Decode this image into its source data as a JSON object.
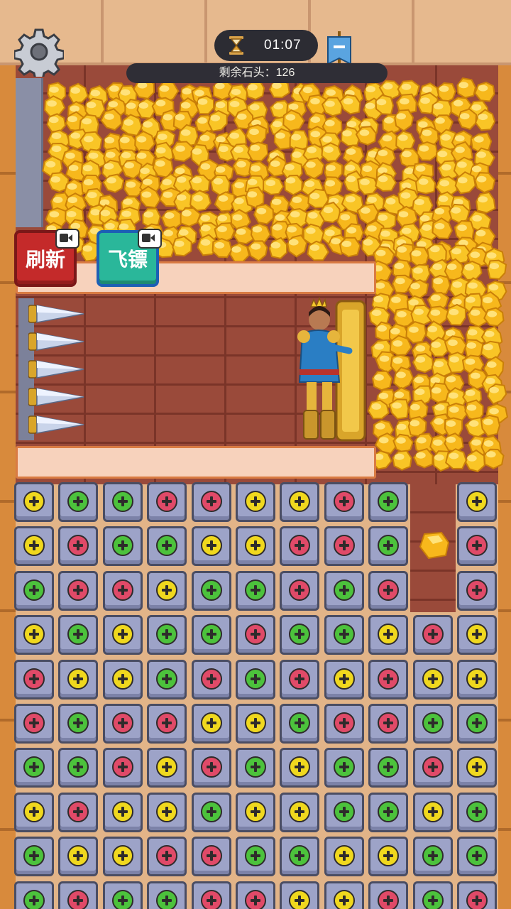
{
  "hud": {
    "timer": "01:07",
    "stones_text": "剩余石头：126"
  },
  "buttons": {
    "refresh_label": "刷新",
    "dart_label": "飞镖"
  },
  "icons": {
    "settings": "gear-icon",
    "timer": "hourglass-icon",
    "flag": "banner-flag-icon",
    "video": "video-ad-icon"
  },
  "colors": {
    "screw_yellow": "#f0d81e",
    "screw_green": "#4cc23c",
    "screw_red": "#e04a68",
    "gold": "#f7b81c",
    "tile": "#9da3c8"
  },
  "board": {
    "rows": [
      [
        "Y",
        "G",
        "G",
        "R",
        "R",
        "Y",
        "Y",
        "R",
        "G",
        "",
        "Y"
      ],
      [
        "Y",
        "R",
        "G",
        "G",
        "Y",
        "Y",
        "R",
        "R",
        "G",
        "",
        "R"
      ],
      [
        "G",
        "R",
        "R",
        "Y",
        "G",
        "G",
        "R",
        "G",
        "R",
        "",
        "R"
      ],
      [
        "Y",
        "G",
        "Y",
        "G",
        "G",
        "R",
        "G",
        "G",
        "Y",
        "R",
        "Y"
      ],
      [
        "R",
        "Y",
        "Y",
        "G",
        "R",
        "G",
        "R",
        "Y",
        "R",
        "Y",
        "Y"
      ],
      [
        "R",
        "G",
        "R",
        "R",
        "Y",
        "Y",
        "G",
        "R",
        "R",
        "G",
        "G"
      ],
      [
        "G",
        "G",
        "R",
        "Y",
        "R",
        "G",
        "Y",
        "G",
        "G",
        "R",
        "Y"
      ],
      [
        "Y",
        "R",
        "Y",
        "Y",
        "G",
        "Y",
        "Y",
        "G",
        "G",
        "Y",
        "G"
      ],
      [
        "G",
        "Y",
        "Y",
        "R",
        "R",
        "G",
        "G",
        "Y",
        "Y",
        "G",
        "G"
      ],
      [
        "G",
        "R",
        "G",
        "G",
        "R",
        "R",
        "Y",
        "Y",
        "R",
        "G",
        "R"
      ]
    ]
  }
}
